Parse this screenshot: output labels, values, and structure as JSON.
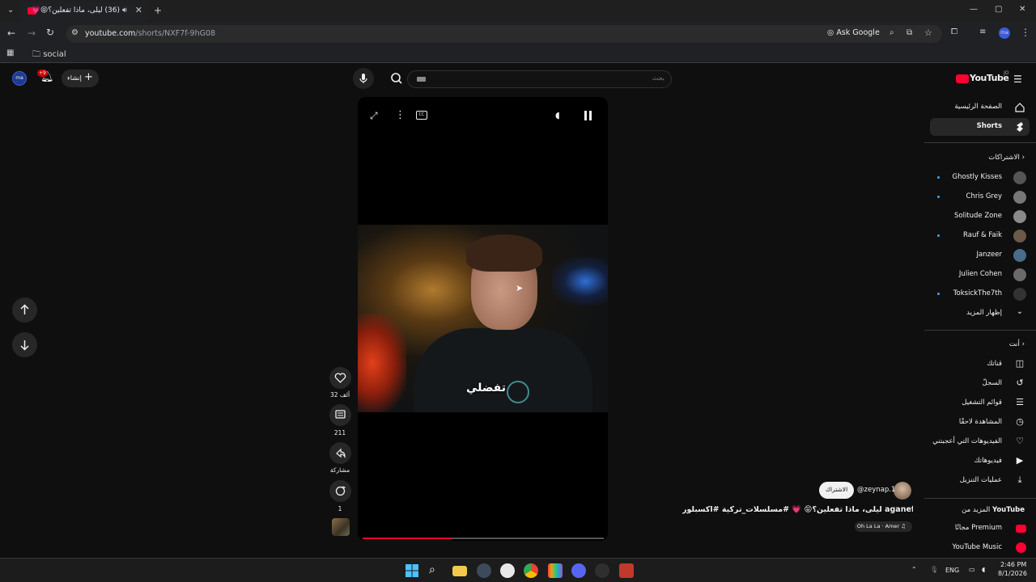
{
  "browser": {
    "tab_title": "(36) ليلى، ماذا تفعلين؟😝💗",
    "url_host": "youtube.com",
    "url_path": "/shorts/NXF7f-9hG08",
    "ask_google": "Ask Google",
    "bookmark_folder": "social"
  },
  "header": {
    "logo_text": "YouTube",
    "region": "JO",
    "search_placeholder": "بحث",
    "create_label": "إنشاء",
    "notif_count": "+9",
    "account": "ma"
  },
  "sidebar": {
    "home": "الصفحة الرئيسية",
    "shorts": "Shorts",
    "subs_header": "الاشتراكات",
    "subscriptions": [
      {
        "name": "Ghostly Kisses",
        "new": true
      },
      {
        "name": "Chris Grey",
        "new": true
      },
      {
        "name": "Solitude Zone",
        "new": false
      },
      {
        "name": "Rauf & Faik",
        "new": true
      },
      {
        "name": "Janzeer",
        "new": false
      },
      {
        "name": "Julien Cohen",
        "new": false
      },
      {
        "name": "ToksickThe7th",
        "new": true
      }
    ],
    "show_more": "إظهار المزيد",
    "you_header": "أنت",
    "you_items": [
      {
        "label": "قناتك",
        "icon": "channel-icon"
      },
      {
        "label": "السجلّ",
        "icon": "history-icon"
      },
      {
        "label": "قوائم التشغيل",
        "icon": "playlists-icon"
      },
      {
        "label": "المشاهدة لاحقًا",
        "icon": "watch-later-icon"
      },
      {
        "label": "الفيديوهات التي أعجبتني",
        "icon": "like-icon"
      },
      {
        "label": "فيديوهاتك",
        "icon": "your-videos-icon"
      },
      {
        "label": "عمليات التنزيل",
        "icon": "download-icon"
      }
    ],
    "more_from_prefix": "المزيد من",
    "more_from_brand": "YouTube",
    "premium": "Premium",
    "premium_note": "مجانًا",
    "music": "YouTube Music"
  },
  "video": {
    "caption": "تفضلي",
    "progress": 0.37
  },
  "actions": {
    "likes": "32 ألف",
    "comments": "211",
    "share": "مشاركة",
    "remix": "1"
  },
  "info": {
    "channel": "@zeynap.1",
    "subscribe": "الاشتراك",
    "title": "ليلى، ماذا تفعلين؟😝 💗 #مسلسلات_تركية #اكسبلور aganefeak...",
    "sound": "Oh La La · Amer ♫"
  },
  "taskbar": {
    "lang": "ENG",
    "time": "2:46 PM",
    "date": "8/1/2026"
  },
  "colors": {
    "accent": "#ff0033",
    "background": "#0f0f0f",
    "sidebar_active": "#272727"
  }
}
